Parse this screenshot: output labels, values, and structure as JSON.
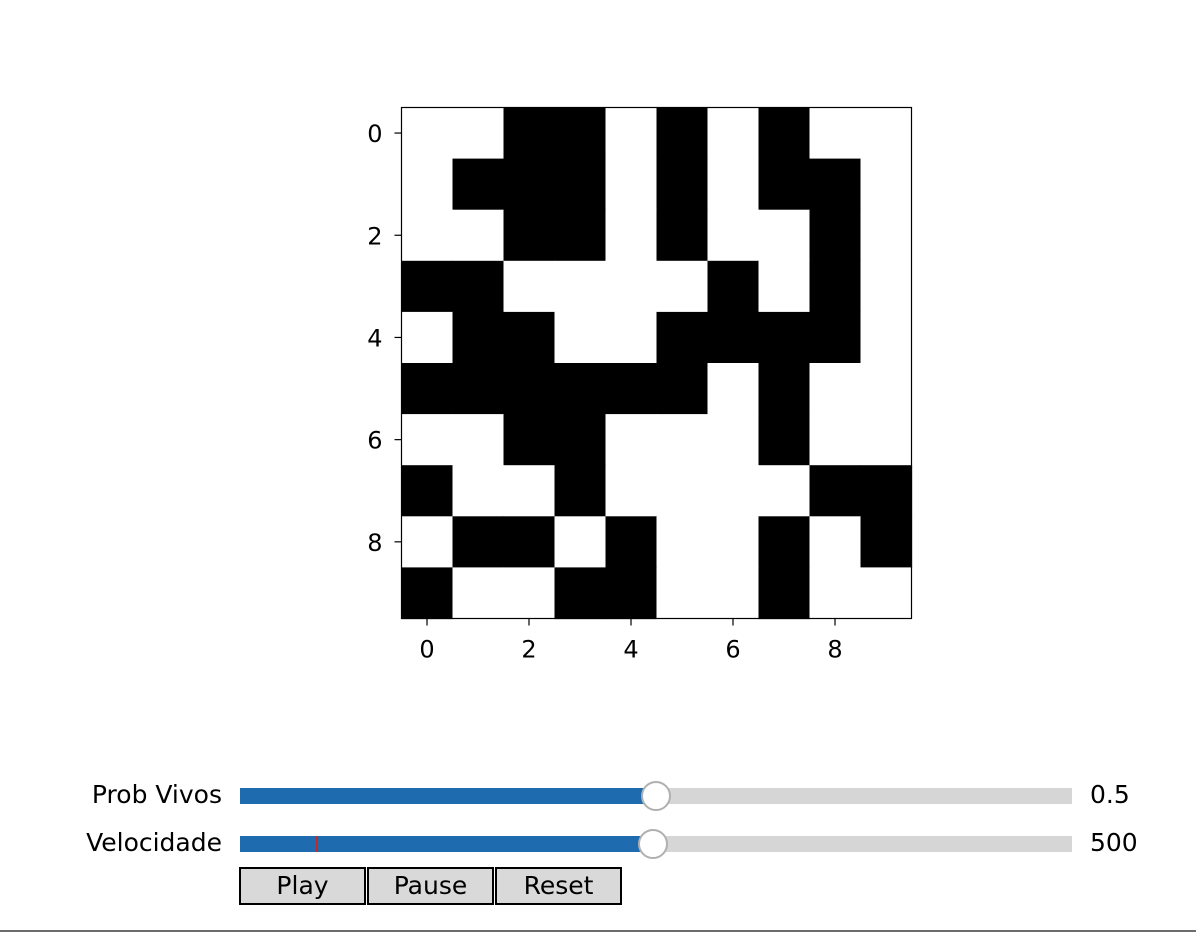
{
  "grid": {
    "rows": 10,
    "cols": 10,
    "cells": [
      [
        0,
        0,
        1,
        1,
        0,
        1,
        0,
        1,
        0,
        0
      ],
      [
        0,
        1,
        1,
        1,
        0,
        1,
        0,
        1,
        1,
        0
      ],
      [
        0,
        0,
        1,
        1,
        0,
        1,
        0,
        0,
        1,
        0
      ],
      [
        1,
        1,
        0,
        0,
        0,
        0,
        1,
        0,
        1,
        0
      ],
      [
        0,
        1,
        1,
        0,
        0,
        1,
        1,
        1,
        1,
        0
      ],
      [
        1,
        1,
        1,
        1,
        1,
        1,
        0,
        1,
        0,
        0
      ],
      [
        0,
        0,
        1,
        1,
        0,
        0,
        0,
        1,
        0,
        0
      ],
      [
        1,
        0,
        0,
        1,
        0,
        0,
        0,
        0,
        1,
        1
      ],
      [
        0,
        1,
        1,
        0,
        1,
        0,
        0,
        1,
        0,
        1
      ],
      [
        1,
        0,
        0,
        1,
        1,
        0,
        0,
        1,
        0,
        0
      ]
    ],
    "alive_color": "#000000",
    "dead_color": "#ffffff",
    "x_ticks": [
      "0",
      "2",
      "4",
      "6",
      "8"
    ],
    "y_ticks": [
      "0",
      "2",
      "4",
      "6",
      "8"
    ]
  },
  "sliders": [
    {
      "id": "prob",
      "label": "Prob Vivos",
      "value_text": "0.5",
      "fraction": 0.5,
      "marker": null
    },
    {
      "id": "speed",
      "label": "Velocidade",
      "value_text": "500",
      "fraction": 0.496,
      "marker": 0.092
    }
  ],
  "slider_colors": {
    "fill": "#1f6bb0",
    "track": "#d6d6d6",
    "marker": "#c62828"
  },
  "buttons": {
    "play": "Play",
    "pause": "Pause",
    "reset": "Reset"
  }
}
